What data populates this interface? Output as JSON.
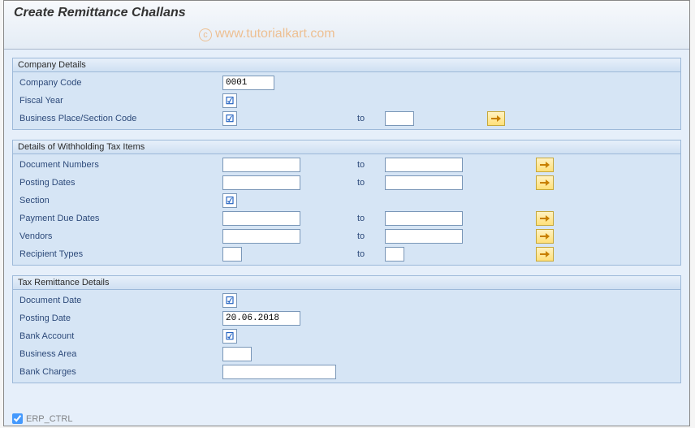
{
  "title": "Create Remittance Challans",
  "watermark": "www.tutorialkart.com",
  "labels": {
    "to": "to"
  },
  "groups": {
    "company": {
      "header": "Company Details",
      "company_code_label": "Company Code",
      "company_code_value": "0001",
      "fiscal_year_label": "Fiscal Year",
      "bupla_label": "Business Place/Section Code"
    },
    "wht": {
      "header": "Details of Withholding Tax Items",
      "doc_numbers_label": "Document Numbers",
      "posting_dates_label": "Posting Dates",
      "section_label": "Section",
      "payment_due_label": "Payment Due Dates",
      "vendors_label": "Vendors",
      "recipient_types_label": "Recipient Types"
    },
    "remit": {
      "header": "Tax Remittance Details",
      "doc_date_label": "Document Date",
      "posting_date_label": "Posting Date",
      "posting_date_value": "20.06.2018",
      "bank_account_label": "Bank Account",
      "business_area_label": "Business Area",
      "bank_charges_label": "Bank Charges"
    }
  },
  "footer": {
    "label": "ERP_CTRL"
  }
}
